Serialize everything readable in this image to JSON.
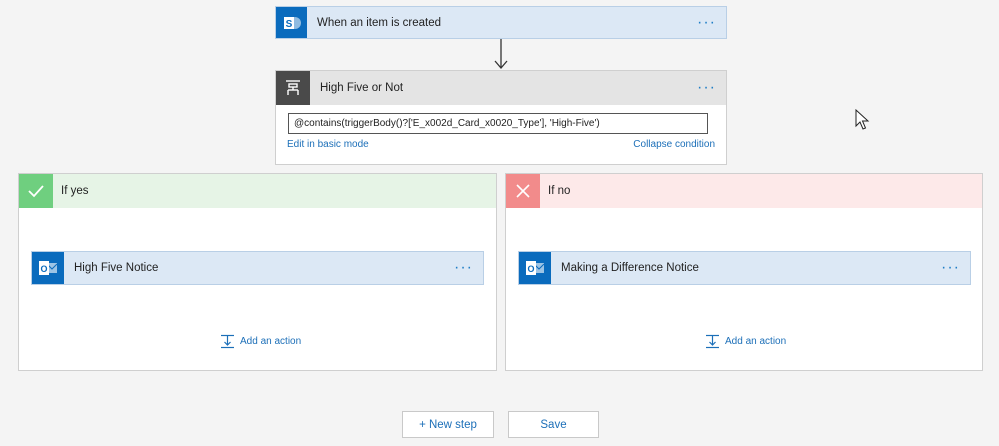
{
  "trigger": {
    "title": "When an item is created",
    "icon": "sharepoint-icon",
    "icon_color": "#0a6bbd",
    "more_label": "···"
  },
  "condition": {
    "title": "High Five or Not",
    "icon": "condition-icon",
    "expression": "@contains(triggerBody()?['E_x002d_Card_x0020_Type'], 'High-Five')",
    "edit_basic_label": "Edit in basic mode",
    "collapse_label": "Collapse condition",
    "more_label": "···"
  },
  "branch_yes": {
    "title": "If yes",
    "icon": "check-icon",
    "color": "#6fcf7f",
    "action": {
      "title": "High Five Notice",
      "icon": "outlook-icon",
      "more_label": "···"
    },
    "add_action_label": "Add an action"
  },
  "branch_no": {
    "title": "If no",
    "icon": "close-icon",
    "color": "#f28b8b",
    "action": {
      "title": "Making a Difference Notice",
      "icon": "outlook-icon",
      "more_label": "···"
    },
    "add_action_label": "Add an action"
  },
  "footer": {
    "new_step_label": "+ New step",
    "save_label": "Save"
  }
}
